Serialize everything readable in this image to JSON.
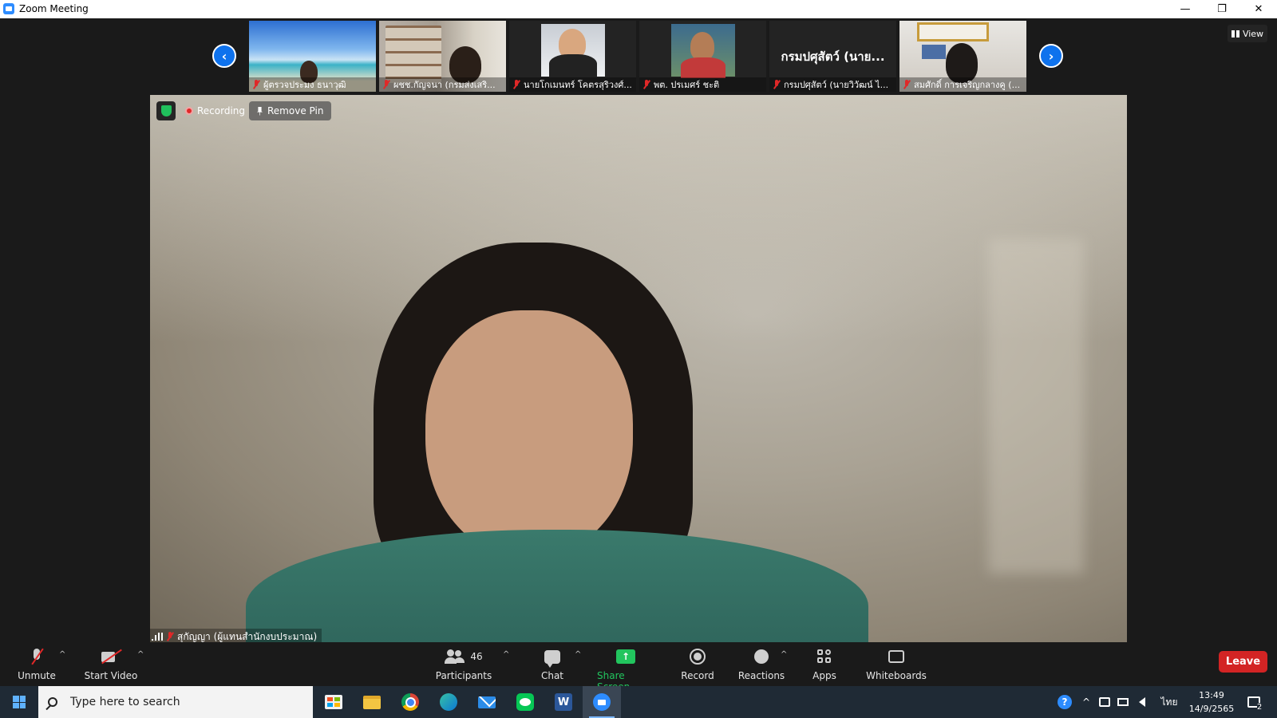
{
  "window": {
    "title": "Zoom Meeting",
    "minimize": "—",
    "restore": "❐",
    "close": "✕"
  },
  "gallery": {
    "prev_arrow": "‹",
    "next_arrow": "›",
    "view_label": "View",
    "thumbnails": [
      {
        "name": "ผู้ตรวจประมง ธนาวุฒิ",
        "has_video": true
      },
      {
        "name": "ผชช.กัญจนา (กรมส่งเสริ...",
        "has_video": true
      },
      {
        "name": "นายโกเมนทร์ โคตรสุริวงศ์...",
        "has_video": true
      },
      {
        "name": "พต. ปรเมศร์ ชะติ",
        "has_video": true
      },
      {
        "name": "กรมปศุสัตว์ (นายวิวัฒน์ ไ...",
        "has_video": false,
        "big_name": "กรมปศุสัตว์ (นาย..."
      },
      {
        "name": "สมศักดิ์ การเจริญกลางคู (...",
        "has_video": true
      }
    ]
  },
  "main": {
    "recording_label": "Recording",
    "remove_pin_label": "Remove Pin",
    "speaker_name": "สุกัญญา (ผู้แทนสำนักงบประมาณ)"
  },
  "toolbar": {
    "unmute": "Unmute",
    "start_video": "Start Video",
    "participants": "Participants",
    "participants_count": "46",
    "chat": "Chat",
    "share_screen": "Share Screen",
    "share_icon": "↑",
    "record": "Record",
    "reactions": "Reactions",
    "apps": "Apps",
    "whiteboards": "Whiteboards",
    "leave": "Leave",
    "caret": "^"
  },
  "taskbar": {
    "search_placeholder": "Type here to search",
    "help_icon": "?",
    "chevron": "^",
    "language": "ไทย",
    "time": "13:49",
    "date": "14/9/2565",
    "notifications_count": "2"
  },
  "colors": {
    "zoom_blue": "#0e72ed",
    "share_green": "#22c55e",
    "leave_red": "#d32424",
    "muted_red": "#e02828"
  }
}
